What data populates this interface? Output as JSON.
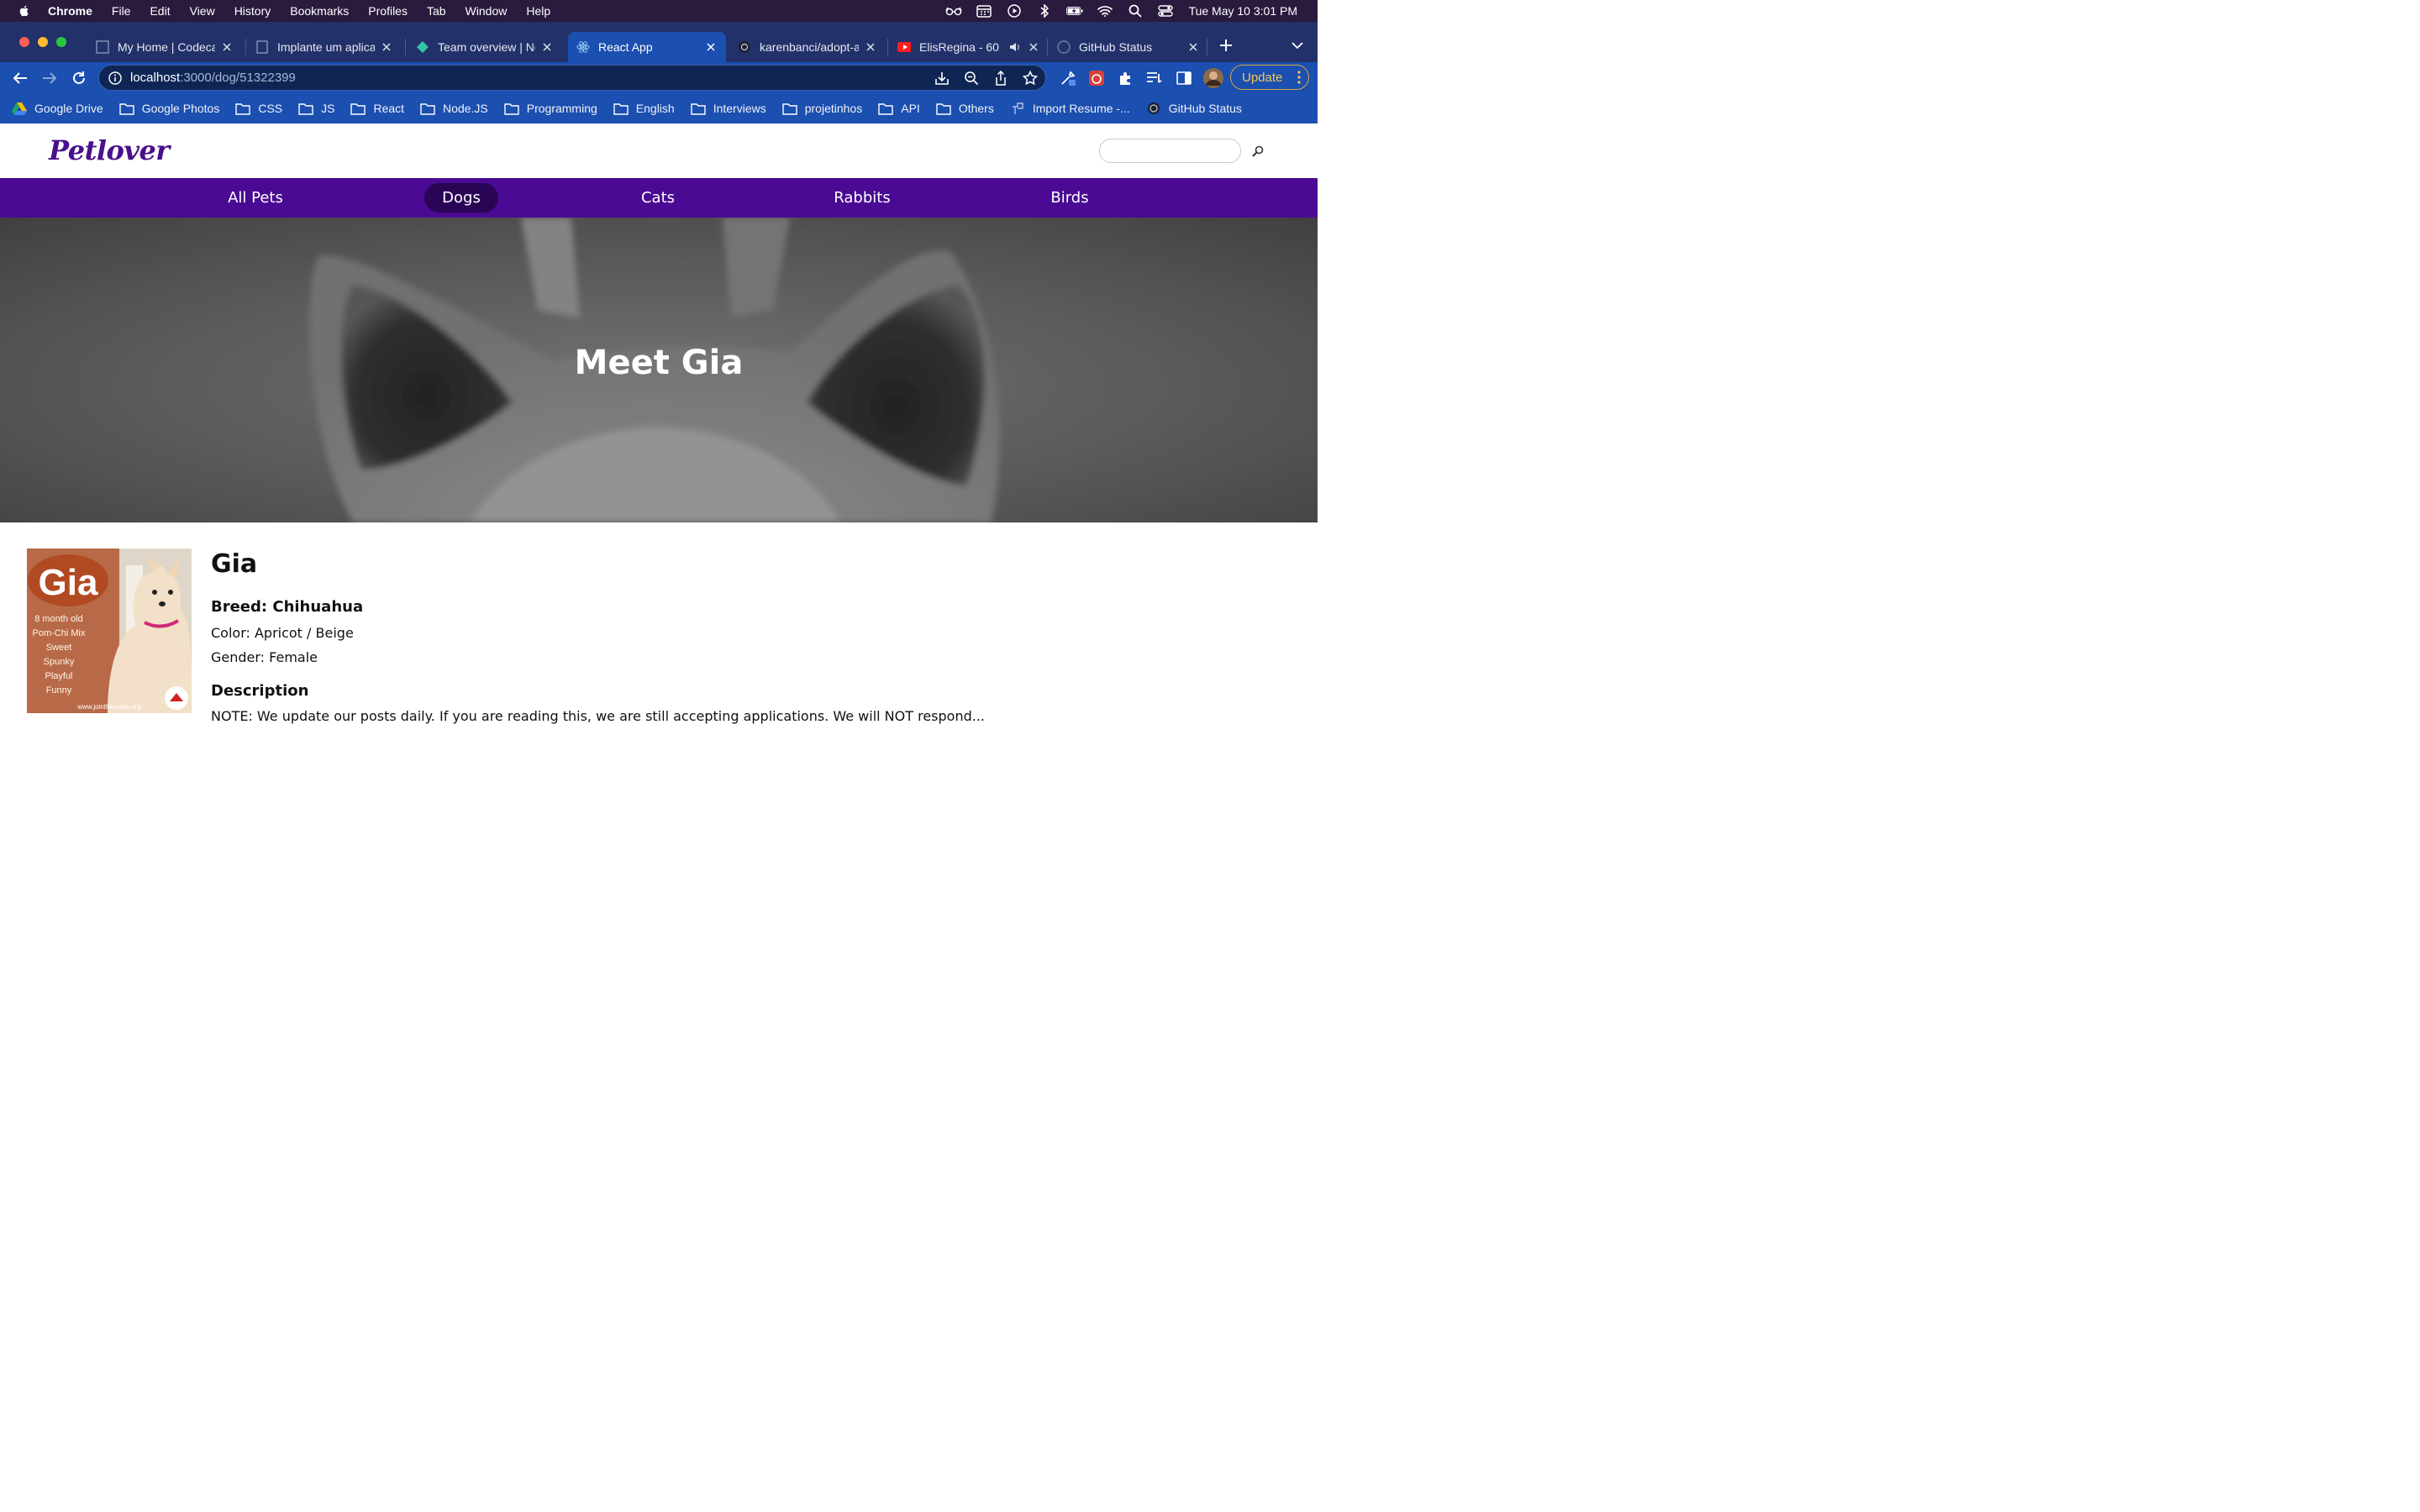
{
  "menubar": {
    "app": "Chrome",
    "items": [
      "File",
      "Edit",
      "View",
      "History",
      "Bookmarks",
      "Profiles",
      "Tab",
      "Window",
      "Help"
    ],
    "clock": "Tue May 10  3:01 PM"
  },
  "tabs": [
    {
      "title": "My Home | Codecad",
      "active": false
    },
    {
      "title": "Implante um aplicat",
      "active": false
    },
    {
      "title": "Team overview | Ne",
      "active": false
    },
    {
      "title": "React App",
      "active": true
    },
    {
      "title": "karenbanci/adopt-a",
      "active": false
    },
    {
      "title": "ElisRegina - 60",
      "active": false
    },
    {
      "title": "GitHub Status",
      "active": false
    }
  ],
  "toolbar": {
    "url_host": "localhost",
    "url_rest": ":3000/dog/51322399",
    "update_label": "Update"
  },
  "bookmarks": [
    "Google Drive",
    "Google Photos",
    "CSS",
    "JS",
    "React",
    "Node.JS",
    "Programming",
    "English",
    "Interviews",
    "projetinhos",
    "API",
    "Others",
    "Import Resume -...",
    "GitHub Status"
  ],
  "site": {
    "logo": "Petlover",
    "search_placeholder": "",
    "nav": [
      "All Pets",
      "Dogs",
      "Cats",
      "Rabbits",
      "Birds"
    ],
    "active_nav": "Dogs"
  },
  "hero": {
    "title": "Meet Gia"
  },
  "pet": {
    "name": "Gia",
    "breed": "Breed: Chihuahua",
    "color": "Color: Apricot / Beige",
    "gender": "Gender: Female",
    "description_heading": "Description",
    "description": "NOTE: We update our posts daily. If you are reading this, we are still accepting applications. We will NOT respond...",
    "photo_text": {
      "badge": "Gia",
      "lines": [
        "8 month old",
        "Pom-Chi Mix",
        "Sweet",
        "Spunky",
        "Playful",
        "Funny"
      ],
      "footer": "www.jointhescars.org"
    }
  },
  "colors": {
    "brand_purple": "#4a0a93",
    "active_nav": "#2a0556",
    "chrome_blue": "#1b4fb0"
  }
}
